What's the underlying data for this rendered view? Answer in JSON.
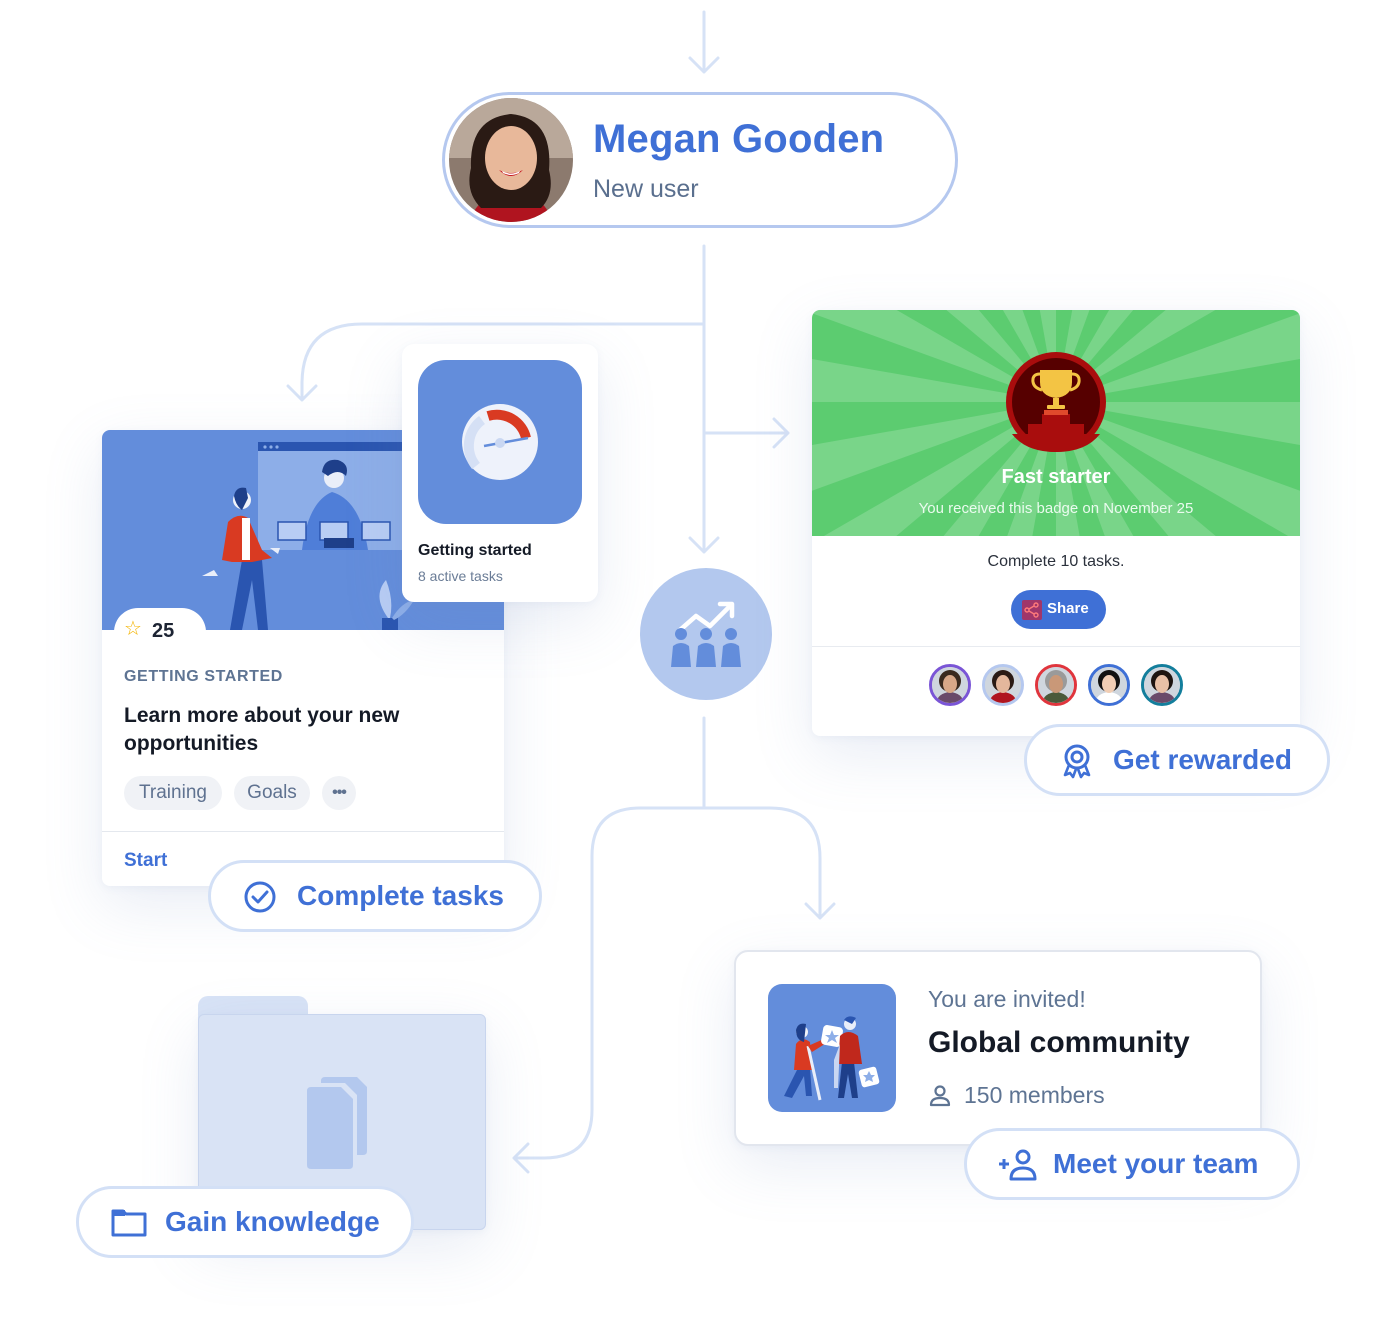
{
  "user": {
    "name": "Megan Gooden",
    "role": "New user"
  },
  "task_card": {
    "points": "25",
    "category": "GETTING STARTED",
    "title": "Learn more about your new opportunities",
    "tags": [
      "Training",
      "Goals"
    ],
    "more_label": "•••",
    "action": "Start"
  },
  "getting_started": {
    "title": "Getting started",
    "subtitle": "8 active tasks"
  },
  "badge": {
    "name": "Fast starter",
    "received": "You received this badge on November 25",
    "requirement": "Complete 10 tasks.",
    "share_label": "Share",
    "peer_count": 5,
    "peer_ring_colors": [
      "#7a55d6",
      "#b5c8ef",
      "#e0353d",
      "#3f70d6",
      "#137e9c"
    ]
  },
  "community": {
    "invite": "You are invited!",
    "title": "Global community",
    "members": "150 members"
  },
  "steps": {
    "rewarded": "Get rewarded",
    "complete": "Complete tasks",
    "team": "Meet your team",
    "knowledge": "Gain knowledge"
  },
  "colors": {
    "accent": "#3f70d6",
    "connector": "#d6e2f6",
    "illustration_bg": "#638ddb",
    "badge_green": "#5ccc70",
    "badge_red": "#a90d0d",
    "trophy_gold": "#f3c444"
  }
}
